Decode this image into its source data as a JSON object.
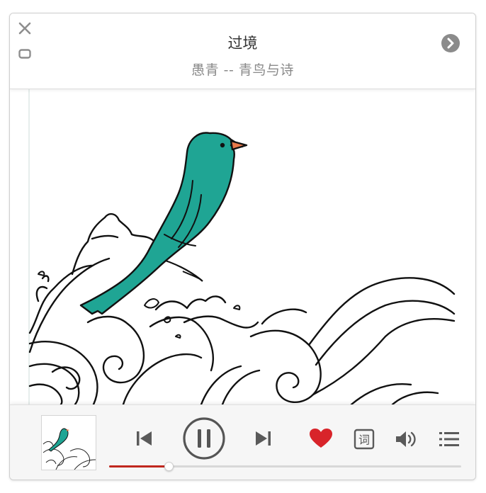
{
  "header": {
    "title": "过境",
    "subtitle": "愚青 -- 青鸟与诗"
  },
  "player": {
    "state": "playing",
    "liked": true,
    "progress": 0.17
  },
  "colors": {
    "accent": "#c0271e",
    "heart": "#d8242a",
    "bird": "#1fa594",
    "beak": "#e8794a",
    "icon": "#5a5a5a"
  },
  "icons": {
    "close": "close-icon",
    "mini_mode": "mini-mode-icon",
    "next_page": "chevron-right-circle-icon",
    "prev": "skip-previous-icon",
    "play_pause": "pause-icon",
    "next": "skip-next-icon",
    "like": "heart-icon",
    "lyrics": "lyrics-icon",
    "volume": "volume-icon",
    "playlist": "playlist-icon"
  },
  "lyrics_button_char": "词"
}
